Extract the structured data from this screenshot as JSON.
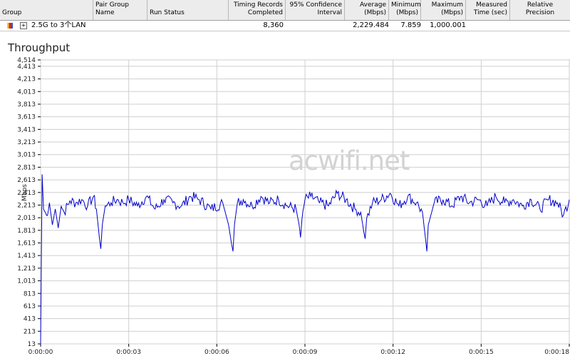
{
  "table": {
    "headers": {
      "group": "Group",
      "pair_group_name": "Pair Group\nName",
      "run_status": "Run Status",
      "timing_records": "Timing Records\nCompleted",
      "confidence": "95% Confidence\nInterval",
      "average": "Average\n(Mbps)",
      "minimum": "Minimum\n(Mbps)",
      "maximum": "Maximum\n(Mbps)",
      "measured_time": "Measured\nTime (sec)",
      "relative_precision": "Relative\nPrecision"
    },
    "row": {
      "group": "2.5G to 3个LAN",
      "expand": "+",
      "timing_records": "8,360",
      "average": "2,229.484",
      "minimum": "7.859",
      "maximum": "1,000.001"
    }
  },
  "chart_title": "Throughput",
  "watermark": "acwifi.net",
  "chart_data": {
    "type": "line",
    "title": "Throughput",
    "ylabel": "Mbps",
    "ylim": [
      13,
      4514
    ],
    "y_ticks": [
      "4,514",
      "4,413",
      "4,213",
      "4,013",
      "3,813",
      "3,613",
      "3,413",
      "3,213",
      "3,013",
      "2,813",
      "2,613",
      "2,413",
      "2,213",
      "2,013",
      "1,813",
      "1,613",
      "1,413",
      "1,213",
      "1,013",
      "813",
      "613",
      "413",
      "213",
      "13"
    ],
    "x_ticks": [
      "0:00:00",
      "0:00:03",
      "0:00:06",
      "0:00:09",
      "0:00:12",
      "0:00:15",
      "0:00:18"
    ],
    "xlim": [
      0,
      18
    ],
    "grid": true,
    "line_color": "#0000cc",
    "series": [
      {
        "x": [
          0,
          0.05,
          0.1,
          0.2,
          0.3,
          0.4,
          0.5,
          0.6,
          0.7,
          0.8,
          1.0,
          1.2,
          1.4,
          1.6,
          1.8,
          1.9,
          2.0,
          2.05,
          2.1,
          2.2,
          2.4,
          2.6,
          2.8,
          3.0,
          3.3,
          3.6,
          3.9,
          4.2,
          4.5,
          4.8,
          5.1,
          5.4,
          5.8,
          6.2,
          6.4,
          6.5,
          6.55,
          6.6,
          6.7,
          6.9,
          7.2,
          7.5,
          7.8,
          8.1,
          8.4,
          8.7,
          8.8,
          8.85,
          8.9,
          9.0,
          9.2,
          9.5,
          9.8,
          10.1,
          10.4,
          10.7,
          10.9,
          11.0,
          11.05,
          11.1,
          11.3,
          11.6,
          11.9,
          12.2,
          12.5,
          12.8,
          13.0,
          13.1,
          13.15,
          13.2,
          13.4,
          13.7,
          14.0,
          14.3,
          14.6,
          14.9,
          15.2,
          15.5,
          15.8,
          16.1,
          16.4,
          16.7,
          17.0,
          17.3,
          17.6,
          17.8,
          18.0
        ],
        "values": [
          13,
          2700,
          2150,
          2050,
          2250,
          1900,
          2150,
          1850,
          2200,
          2100,
          2280,
          2250,
          2300,
          2200,
          2350,
          2150,
          1700,
          1520,
          1900,
          2200,
          2250,
          2300,
          2250,
          2300,
          2200,
          2350,
          2150,
          2300,
          2250,
          2200,
          2350,
          2300,
          2150,
          2250,
          1900,
          1600,
          1480,
          1900,
          2250,
          2300,
          2200,
          2350,
          2250,
          2300,
          2200,
          2150,
          1900,
          1700,
          2000,
          2300,
          2350,
          2250,
          2200,
          2400,
          2300,
          2150,
          2100,
          1800,
          1680,
          2000,
          2250,
          2300,
          2400,
          2200,
          2350,
          2250,
          2100,
          1700,
          1480,
          1900,
          2250,
          2300,
          2200,
          2350,
          2250,
          2300,
          2200,
          2350,
          2250,
          2300,
          2200,
          2300,
          2150,
          2300,
          2250,
          2050,
          2300
        ]
      }
    ]
  }
}
